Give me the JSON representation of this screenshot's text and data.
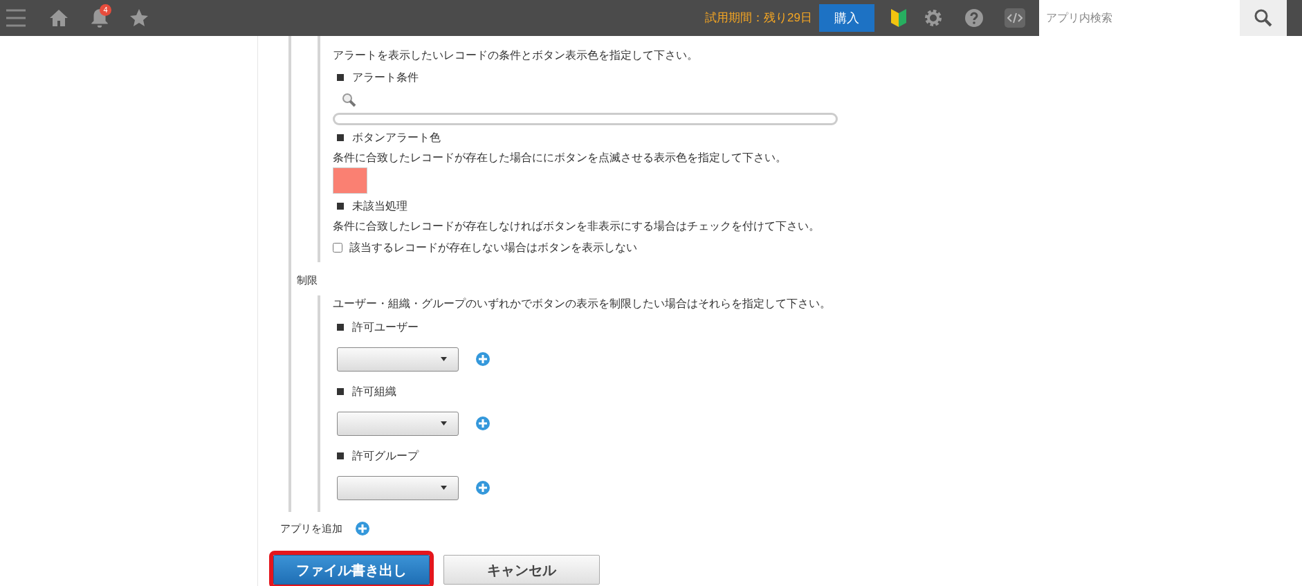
{
  "header": {
    "notification_count": "4",
    "trial": "試用期間：残り29日",
    "buy_button": "購入",
    "search": {
      "placeholder": "アプリ内検索"
    }
  },
  "alert_section": {
    "description": "アラートを表示したいレコードの条件とボタン表示色を指定して下さい。",
    "condition": {
      "heading": "アラート条件"
    },
    "button_color": {
      "heading": "ボタンアラート色",
      "description": "条件に合致したレコードが存在した場合ににボタンを点滅させる表示色を指定して下さい。",
      "color": "#fa8072"
    },
    "unmatched": {
      "heading": "未該当処理",
      "description": "条件に合致したレコードが存在しなければボタンを非表示にする場合はチェックを付けて下さい。",
      "checkbox": {
        "label": "該当するレコードが存在しない場合はボタンを表示しない",
        "checked": false
      }
    }
  },
  "restriction": {
    "heading": "制限",
    "description": "ユーザー・組織・グループのいずれかでボタンの表示を制限したい場合はそれらを指定して下さい。",
    "pickers": [
      {
        "heading": "許可ユーザー"
      },
      {
        "heading": "許可組織"
      },
      {
        "heading": "許可グループ"
      }
    ]
  },
  "add_app": {
    "label": "アプリを追加"
  },
  "buttons": [
    {
      "label": "ファイル書き出し",
      "kind": "primary",
      "highlighted": true
    },
    {
      "label": "キャンセル",
      "kind": "secondary",
      "highlighted": false
    }
  ]
}
